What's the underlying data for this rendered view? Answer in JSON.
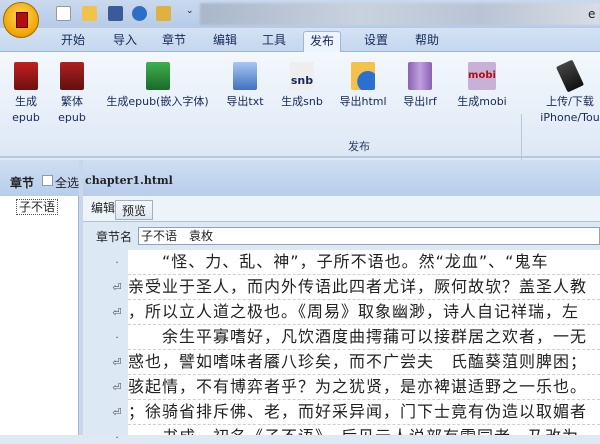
{
  "title_fragment": "e",
  "tabs": [
    "开始",
    "导入",
    "章节",
    "编辑",
    "工具",
    "发布",
    "设置",
    "帮助"
  ],
  "active_tab": "发布",
  "ribbon": {
    "buttons": [
      {
        "label1": "生成",
        "label2": "epub",
        "icon": "epub-icon"
      },
      {
        "label1": "繁体",
        "label2": "epub",
        "icon": "epub-big5-icon"
      },
      {
        "label1": "生成epub(嵌入字体)",
        "label2": "",
        "icon": "epub-font-icon"
      },
      {
        "label1": "导出txt",
        "label2": "",
        "icon": "folder-icon"
      },
      {
        "label1": "生成snb",
        "label2": "",
        "icon": "snb-icon"
      },
      {
        "label1": "导出html",
        "label2": "",
        "icon": "html-icon"
      },
      {
        "label1": "导出lrf",
        "label2": "",
        "icon": "lrf-icon"
      },
      {
        "label1": "生成mobi",
        "label2": "",
        "icon": "mobi-icon"
      },
      {
        "label1": "上传/下载",
        "label2": "iPhone/Tou",
        "icon": "iphone-icon"
      }
    ],
    "group_label": "发布"
  },
  "left_panel": {
    "title": "章节",
    "select_all": "全选",
    "items": [
      "子不语"
    ]
  },
  "file_name": "chapter1.html",
  "editor_tabs": [
    "编辑",
    "预览"
  ],
  "chapter_name_label": "章节名",
  "chapter_name_value": "子不语　袁枚",
  "lines": [
    {
      "marker": "·",
      "text": "　　“怪、力、乱、神”，子所不语也。然“龙血”、“鬼车"
    },
    {
      "marker": "⏎",
      "text": "亲受业于圣人，而内外传语此四者尤详，厥何故欤？盖圣人教"
    },
    {
      "marker": "⏎",
      "text": "，所以立人道之极也。《周易》取象幽渺，诗人自记祥瑞，左"
    },
    {
      "marker": "·",
      "text": "　　余生平寡嗜好，凡饮酒度曲摴蒱可以接群居之欢者，一无"
    },
    {
      "marker": "⏎",
      "text": "惑也，譬如嗜味者餍八珍矣，而不广尝夫　氏醢葵菹则脾困；"
    },
    {
      "marker": "⏎",
      "text": "骇起情，不有博弈者乎？为之犹贤，是亦裨谌适野之一乐也。"
    },
    {
      "marker": "⏎",
      "text": "；徐骑省排斥佛、老，而好采异闻，门下士竟有伪造以取媚者"
    },
    {
      "marker": "·",
      "text": "　　书成，初名《子不语》，后见元人说部有雷同者，乃改为"
    }
  ]
}
